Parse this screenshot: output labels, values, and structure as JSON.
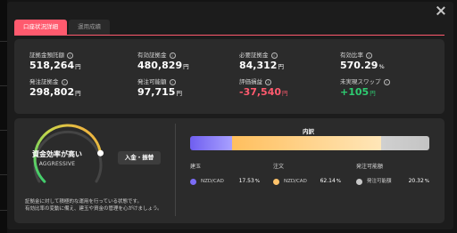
{
  "tabs": [
    {
      "label": "口座状況詳細",
      "active": true
    },
    {
      "label": "運用成績",
      "active": false
    }
  ],
  "stats": [
    {
      "label": "証拠金預託額",
      "value": "518,264",
      "unit": "円",
      "tone": "normal"
    },
    {
      "label": "有効証拠金",
      "value": "480,829",
      "unit": "円",
      "tone": "normal"
    },
    {
      "label": "必要証拠金",
      "value": "84,312",
      "unit": "円",
      "tone": "normal"
    },
    {
      "label": "有効比率",
      "value": "570.29",
      "unit": "%",
      "tone": "normal"
    },
    {
      "label": "発注証拠金",
      "value": "298,802",
      "unit": "円",
      "tone": "normal"
    },
    {
      "label": "発注可能額",
      "value": "97,715",
      "unit": "円",
      "tone": "normal"
    },
    {
      "label": "評価損益",
      "value": "-37,540",
      "unit": "円",
      "tone": "negative"
    },
    {
      "label": "未実現スワップ",
      "value": "+105",
      "unit": "円",
      "tone": "positive"
    }
  ],
  "gauge": {
    "title": "資金効率が高い",
    "subtitle": "AGGRESSIVE",
    "level": 0.8
  },
  "deposit_button": "入金・振替",
  "note": {
    "line1": "証拠金に対して積極的な運用を行っている状態です。",
    "line2": "有効比率の変動に備え、建玉や資金の管理を心がけましょう。"
  },
  "breakdown": {
    "title": "内訳",
    "columns": [
      {
        "heading": "建玉",
        "name": "NZD/CAD",
        "percent": "17.53",
        "unit": "%",
        "color": "#7b6cf6"
      },
      {
        "heading": "注文",
        "name": "NZD/CAD",
        "percent": "62.14",
        "unit": "%",
        "color": "#ffc36b"
      },
      {
        "heading": "発注可能額",
        "name": "発注可能額",
        "percent": "20.32",
        "unit": "%",
        "color": "#c8c8c8"
      }
    ]
  },
  "colors": {
    "accent": "#ff5a6e",
    "negative": "#ff5a6e",
    "positive": "#2ecc71"
  },
  "icons": [
    "close-icon",
    "info-icon"
  ]
}
